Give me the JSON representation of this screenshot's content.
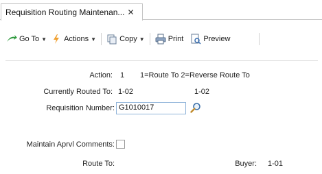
{
  "tab": {
    "title": "Requisition Routing Maintenan...",
    "close_symbol": "✕"
  },
  "toolbar": {
    "goto_label": "Go To",
    "actions_label": "Actions",
    "copy_label": "Copy",
    "print_label": "Print",
    "preview_label": "Preview"
  },
  "form": {
    "action_label": "Action:",
    "action_value": "1",
    "action_hint": "1=Route To 2=Reverse Route To",
    "routed_label": "Currently Routed To:",
    "routed_value_1": "1-02",
    "routed_value_2": "1-02",
    "req_label": "Requisition Number:",
    "req_value": "G1010017",
    "comments_label": "Maintain Aprvl Comments:",
    "route_to_label": "Route To:",
    "buyer_label": "Buyer:",
    "buyer_value": "1-01"
  },
  "colors": {
    "input_border": "#8fb3d9",
    "accent_green": "#2e9a3e",
    "accent_orange": "#f0a030"
  }
}
